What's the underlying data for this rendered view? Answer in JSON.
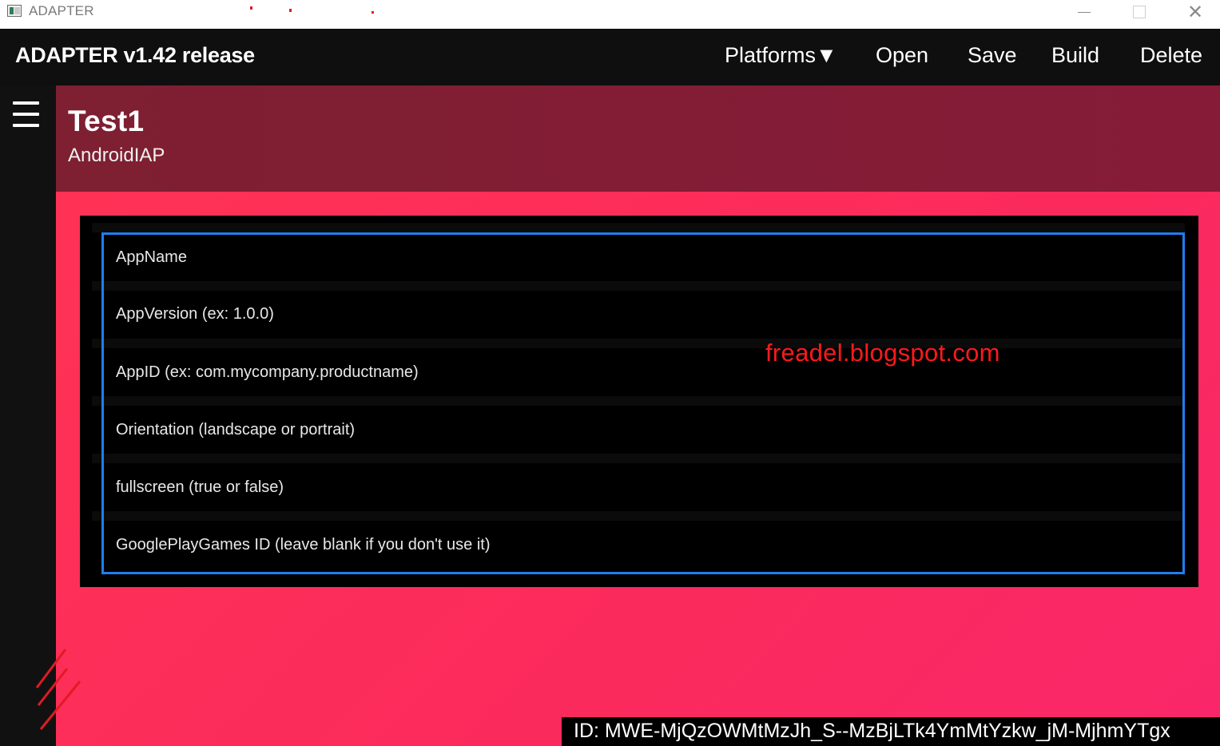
{
  "window": {
    "title": "ADAPTER"
  },
  "header": {
    "brand": "ADAPTER v1.42 release",
    "menu": {
      "platforms": "Platforms▼",
      "open": "Open",
      "save": "Save",
      "build": "Build",
      "delete": "Delete"
    }
  },
  "project": {
    "name": "Test1",
    "type": "AndroidIAP"
  },
  "form": {
    "fields": [
      {
        "placeholder": "AppName"
      },
      {
        "placeholder": "AppVersion (ex: 1.0.0)"
      },
      {
        "placeholder": "AppID (ex: com.mycompany.productname)"
      },
      {
        "placeholder": "Orientation (landscape or portrait)"
      },
      {
        "placeholder": "fullscreen (true or false)"
      },
      {
        "placeholder": "GooglePlayGames ID (leave blank if you don't use it)"
      }
    ]
  },
  "watermark": "freadel.blogspot.com",
  "id_text": "ID: MWE-MjQzOWMtMzJh_S--MzBjLTk4YmMtYzkw_jM-MjhmYTgx",
  "colors": {
    "accent_blue": "#1e7ff0",
    "header_dark": "#0f0f0f",
    "title_band": "#7e1f32",
    "body_pink": "#fb2a5c",
    "watermark_red": "#ff1a1a"
  },
  "icons": [
    "app-icon",
    "minimize-icon",
    "maximize-icon",
    "close-icon",
    "hamburger-menu-icon",
    "slash-marks-icon"
  ]
}
